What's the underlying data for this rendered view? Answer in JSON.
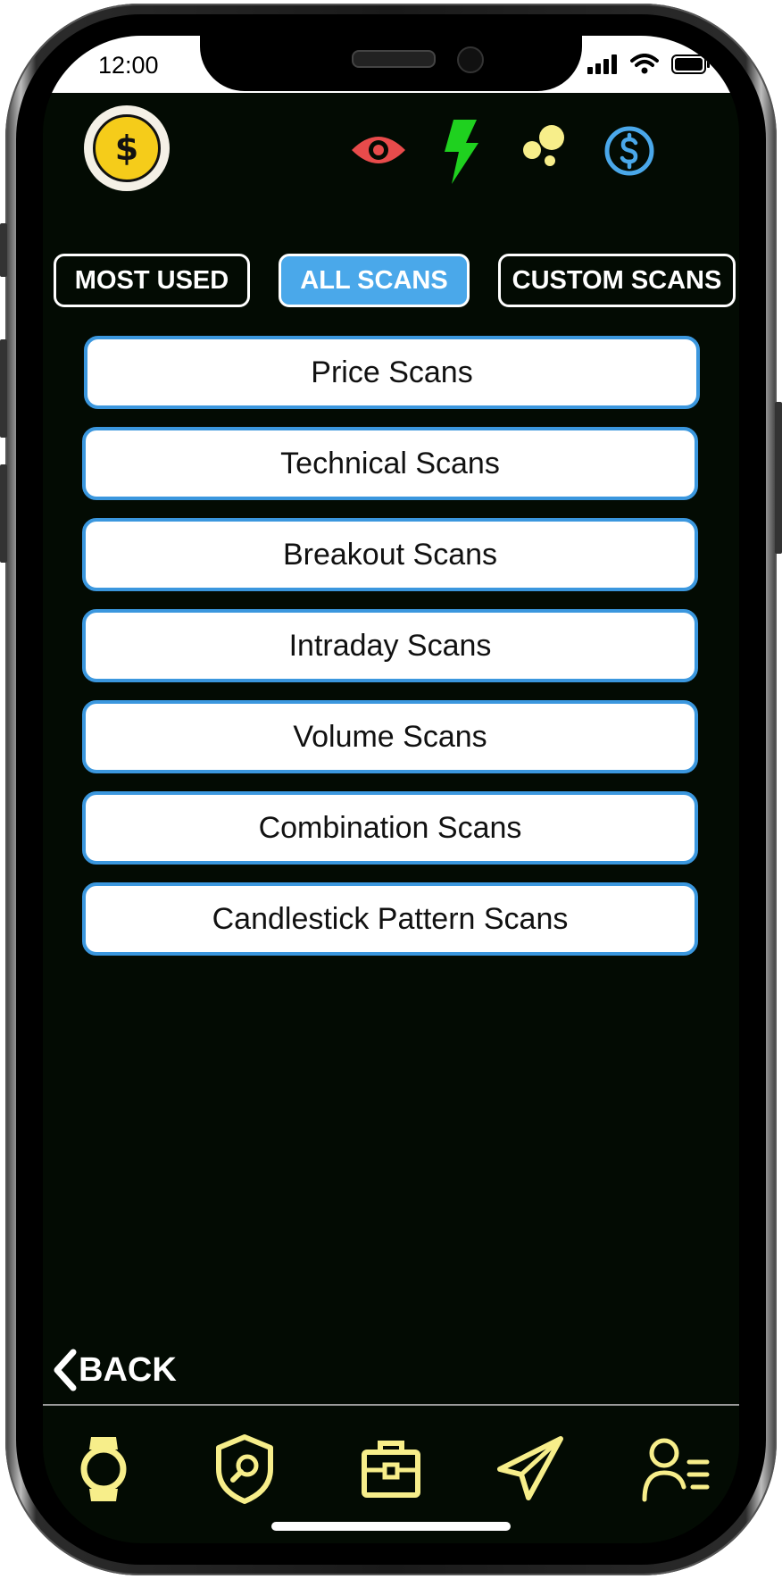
{
  "status_bar": {
    "time": "12:00"
  },
  "header": {
    "coin_symbol": "$",
    "icons": [
      "eye-icon",
      "lightning-icon",
      "bubbles-icon",
      "dollar-circle-icon"
    ]
  },
  "tabs": [
    {
      "label": "MOST USED",
      "active": false
    },
    {
      "label": "ALL SCANS",
      "active": true
    },
    {
      "label": "CUSTOM SCANS",
      "active": false
    }
  ],
  "scans": [
    "Price Scans",
    "Technical Scans",
    "Breakout Scans",
    "Intraday Scans",
    "Volume Scans",
    "Combination Scans",
    "Candlestick Pattern Scans"
  ],
  "back_label": "BACK",
  "bottom_nav": [
    "watch-icon",
    "shield-search-icon",
    "briefcase-icon",
    "paper-plane-icon",
    "user-list-icon"
  ],
  "colors": {
    "background": "#030b03",
    "accent_blue": "#4aa8ea",
    "nav_yellow": "#f7ee8a",
    "eye_red": "#e84b4b",
    "bolt_green": "#1fd11f"
  }
}
